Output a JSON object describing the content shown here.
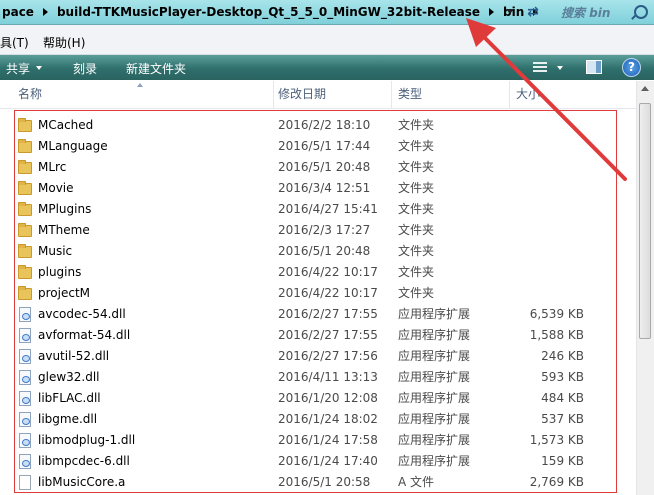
{
  "address": {
    "crumbs": [
      "pace",
      "build-TTKMusicPlayer-Desktop_Qt_5_5_0_MinGW_32bit-Release",
      "bin"
    ],
    "search_placeholder": "搜索 bin"
  },
  "menu": {
    "items": [
      "具(T)",
      "帮助(H)"
    ]
  },
  "command_bar": {
    "share": "共享",
    "burn": "刻录",
    "new_folder": "新建文件夹",
    "help": "?"
  },
  "columns": {
    "name": "名称",
    "date": "修改日期",
    "type": "类型",
    "size": "大小"
  },
  "files": [
    {
      "name": "MCached",
      "date": "2016/2/2 18:10",
      "type": "文件夹",
      "size": "",
      "icon": "folder-icon"
    },
    {
      "name": "MLanguage",
      "date": "2016/5/1 17:44",
      "type": "文件夹",
      "size": "",
      "icon": "folder-icon"
    },
    {
      "name": "MLrc",
      "date": "2016/5/1 20:48",
      "type": "文件夹",
      "size": "",
      "icon": "folder-icon"
    },
    {
      "name": "Movie",
      "date": "2016/3/4 12:51",
      "type": "文件夹",
      "size": "",
      "icon": "folder-icon"
    },
    {
      "name": "MPlugins",
      "date": "2016/4/27 15:41",
      "type": "文件夹",
      "size": "",
      "icon": "folder-icon"
    },
    {
      "name": "MTheme",
      "date": "2016/2/3 17:27",
      "type": "文件夹",
      "size": "",
      "icon": "folder-icon"
    },
    {
      "name": "Music",
      "date": "2016/5/1 20:48",
      "type": "文件夹",
      "size": "",
      "icon": "folder-icon"
    },
    {
      "name": "plugins",
      "date": "2016/4/22 10:17",
      "type": "文件夹",
      "size": "",
      "icon": "folder-icon"
    },
    {
      "name": "projectM",
      "date": "2016/4/22 10:17",
      "type": "文件夹",
      "size": "",
      "icon": "folder-icon"
    },
    {
      "name": "avcodec-54.dll",
      "date": "2016/2/27 17:55",
      "type": "应用程序扩展",
      "size": "6,539 KB",
      "icon": "dll-icon"
    },
    {
      "name": "avformat-54.dll",
      "date": "2016/2/27 17:55",
      "type": "应用程序扩展",
      "size": "1,588 KB",
      "icon": "dll-icon"
    },
    {
      "name": "avutil-52.dll",
      "date": "2016/2/27 17:56",
      "type": "应用程序扩展",
      "size": "246 KB",
      "icon": "dll-icon"
    },
    {
      "name": "glew32.dll",
      "date": "2016/4/11 13:13",
      "type": "应用程序扩展",
      "size": "593 KB",
      "icon": "dll-icon"
    },
    {
      "name": "libFLAC.dll",
      "date": "2016/1/20 12:08",
      "type": "应用程序扩展",
      "size": "484 KB",
      "icon": "dll-icon"
    },
    {
      "name": "libgme.dll",
      "date": "2016/1/24 18:02",
      "type": "应用程序扩展",
      "size": "537 KB",
      "icon": "dll-icon"
    },
    {
      "name": "libmodplug-1.dll",
      "date": "2016/1/24 17:58",
      "type": "应用程序扩展",
      "size": "1,573 KB",
      "icon": "dll-icon"
    },
    {
      "name": "libmpcdec-6.dll",
      "date": "2016/1/24 17:40",
      "type": "应用程序扩展",
      "size": "159 KB",
      "icon": "dll-icon"
    },
    {
      "name": "libMusicCore.a",
      "date": "2016/5/1 20:58",
      "type": "A 文件",
      "size": "2,769 KB",
      "icon": "file-icon"
    }
  ],
  "colors": {
    "annotation": "#e03b3b",
    "command_bar": "#2f6f6c",
    "address_bar": "#7fd0da"
  }
}
